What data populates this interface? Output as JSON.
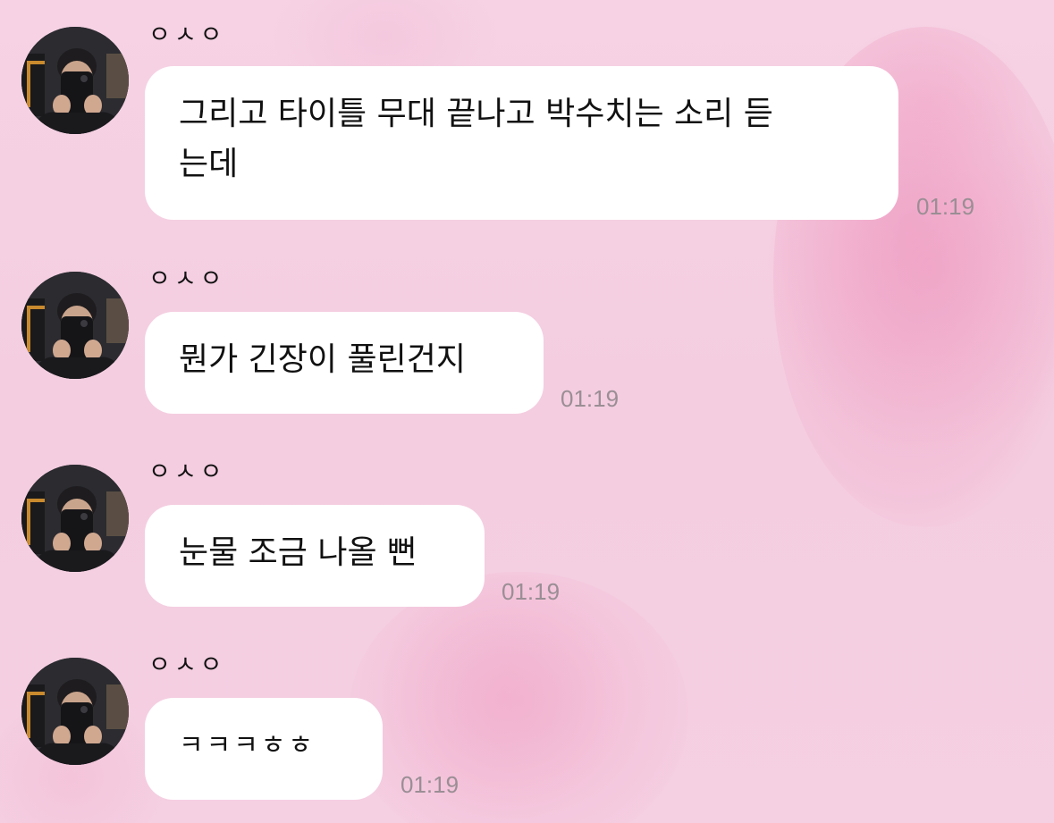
{
  "colors": {
    "background": "#f5cfe1",
    "bubble": "#ffffff",
    "timestamp": "#9a8e94"
  },
  "messages": [
    {
      "sender": "ㅇㅅㅇ",
      "text": "그리고 타이틀 무대 끝나고 박수치는 소리 듣는데",
      "line1": "그리고 타이틀 무대 끝나고 박수치는 소리 듣",
      "line2": "는데",
      "time": "01:19",
      "avatar_icon": "profile-photo"
    },
    {
      "sender": "ㅇㅅㅇ",
      "text": "뭔가 긴장이 풀린건지",
      "time": "01:19",
      "avatar_icon": "profile-photo"
    },
    {
      "sender": "ㅇㅅㅇ",
      "text": "눈물 조금 나올 뻔",
      "time": "01:19",
      "avatar_icon": "profile-photo"
    },
    {
      "sender": "ㅇㅅㅇ",
      "text": "ㅋㅋㅋㅎㅎ",
      "time": "01:19",
      "avatar_icon": "profile-photo"
    }
  ]
}
